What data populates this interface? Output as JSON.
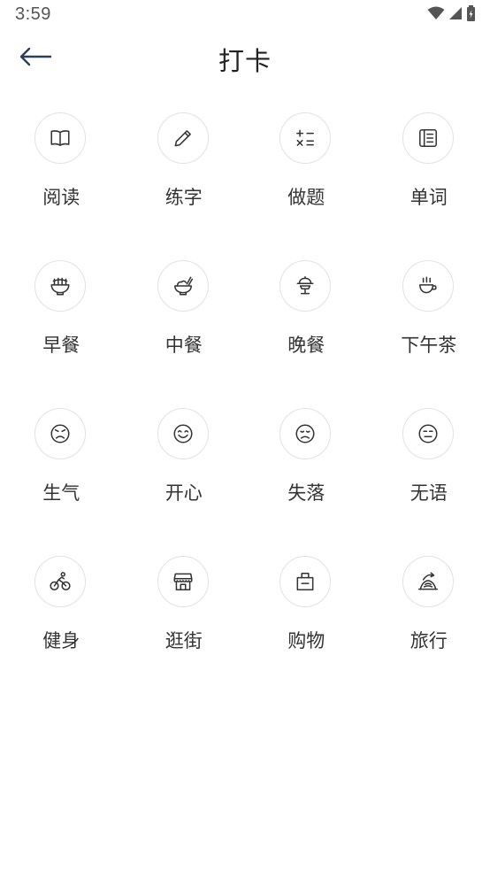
{
  "status_bar": {
    "time": "3:59"
  },
  "header": {
    "title": "打卡"
  },
  "categories": [
    {
      "id": "reading",
      "label": "阅读",
      "icon": "book-icon"
    },
    {
      "id": "writing",
      "label": "练字",
      "icon": "pencil-icon"
    },
    {
      "id": "exercise",
      "label": "做题",
      "icon": "calculator-icon"
    },
    {
      "id": "vocab",
      "label": "单词",
      "icon": "notebook-icon"
    },
    {
      "id": "breakfast",
      "label": "早餐",
      "icon": "noodle-bowl-icon"
    },
    {
      "id": "lunch",
      "label": "中餐",
      "icon": "rice-bowl-icon"
    },
    {
      "id": "dinner",
      "label": "晚餐",
      "icon": "dinner-plate-icon"
    },
    {
      "id": "tea",
      "label": "下午茶",
      "icon": "tea-cup-icon"
    },
    {
      "id": "angry",
      "label": "生气",
      "icon": "angry-face-icon"
    },
    {
      "id": "happy",
      "label": "开心",
      "icon": "happy-face-icon"
    },
    {
      "id": "sad",
      "label": "失落",
      "icon": "sad-face-icon"
    },
    {
      "id": "speechless",
      "label": "无语",
      "icon": "neutral-face-icon"
    },
    {
      "id": "fitness",
      "label": "健身",
      "icon": "cyclist-icon"
    },
    {
      "id": "stroll",
      "label": "逛街",
      "icon": "storefront-icon"
    },
    {
      "id": "shopping",
      "label": "购物",
      "icon": "shopping-bag-icon"
    },
    {
      "id": "travel",
      "label": "旅行",
      "icon": "travel-icon"
    }
  ]
}
